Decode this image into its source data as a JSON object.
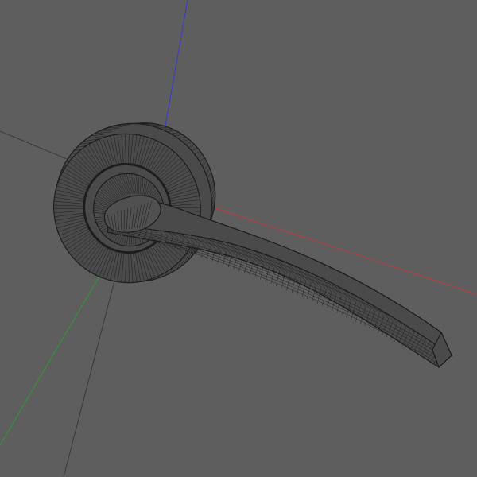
{
  "viewport": {
    "view": "3d-wireframe",
    "background": "#5e5e5e",
    "wire_color": "#1e1e1e",
    "fill_color": "#4a4a4a"
  },
  "axes": {
    "x": {
      "color": "#c23a3a"
    },
    "y": {
      "color": "#2e9a2e"
    },
    "z": {
      "color": "#3a3ad0"
    },
    "grid": {
      "color": "#3c3c3c"
    }
  },
  "model": {
    "object": "door-lever-handle",
    "parts": [
      "rosette",
      "neck",
      "lever"
    ]
  }
}
